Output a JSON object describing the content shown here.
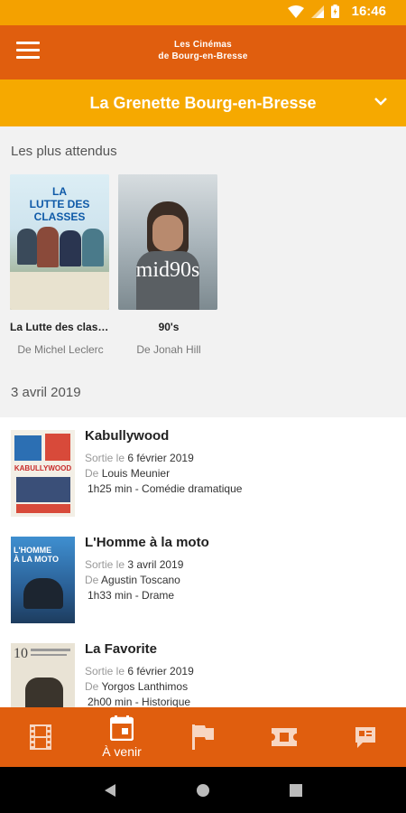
{
  "status_bar": {
    "time": "16:46"
  },
  "app_bar": {
    "brand_line1": "Les Cinémas",
    "brand_line2": "de Bourg-en-Bresse"
  },
  "cinema_selector": {
    "selected": "La Grenette Bourg-en-Bresse"
  },
  "featured": {
    "section_title": "Les plus attendus",
    "items": [
      {
        "title": "La Lutte des class...",
        "director": "De Michel Leclerc",
        "poster_text1": "LA",
        "poster_text2": "LUTTE DES",
        "poster_text3": "CLASSES"
      },
      {
        "title": "90's",
        "director": "De Jonah Hill",
        "poster_text1": "mid90s"
      }
    ]
  },
  "date_section": {
    "title": "3 avril 2019"
  },
  "films": [
    {
      "title": "Kabullywood",
      "release_prefix": "Sortie le ",
      "release_date": "6 février 2019",
      "director_prefix": "De ",
      "director": "Louis Meunier",
      "meta": "1h25 min - Comédie dramatique",
      "poster_text": "KABULLYWOOD"
    },
    {
      "title": "L'Homme à la moto",
      "release_prefix": "Sortie le ",
      "release_date": "3 avril 2019",
      "director_prefix": "De ",
      "director": "Agustin Toscano",
      "meta": "1h33 min - Drame",
      "poster_text": "L'HOMME À LA MOTO"
    },
    {
      "title": "La Favorite",
      "release_prefix": "Sortie le ",
      "release_date": "6 février 2019",
      "director_prefix": "De ",
      "director": "Yorgos Lanthimos",
      "meta": "2h00 min - Historique",
      "poster_text": "10"
    }
  ],
  "bottom_nav": {
    "active_label": "À venir"
  },
  "colors": {
    "primary": "#e05e0e",
    "accent": "#f6a900",
    "status": "#f4a100"
  }
}
